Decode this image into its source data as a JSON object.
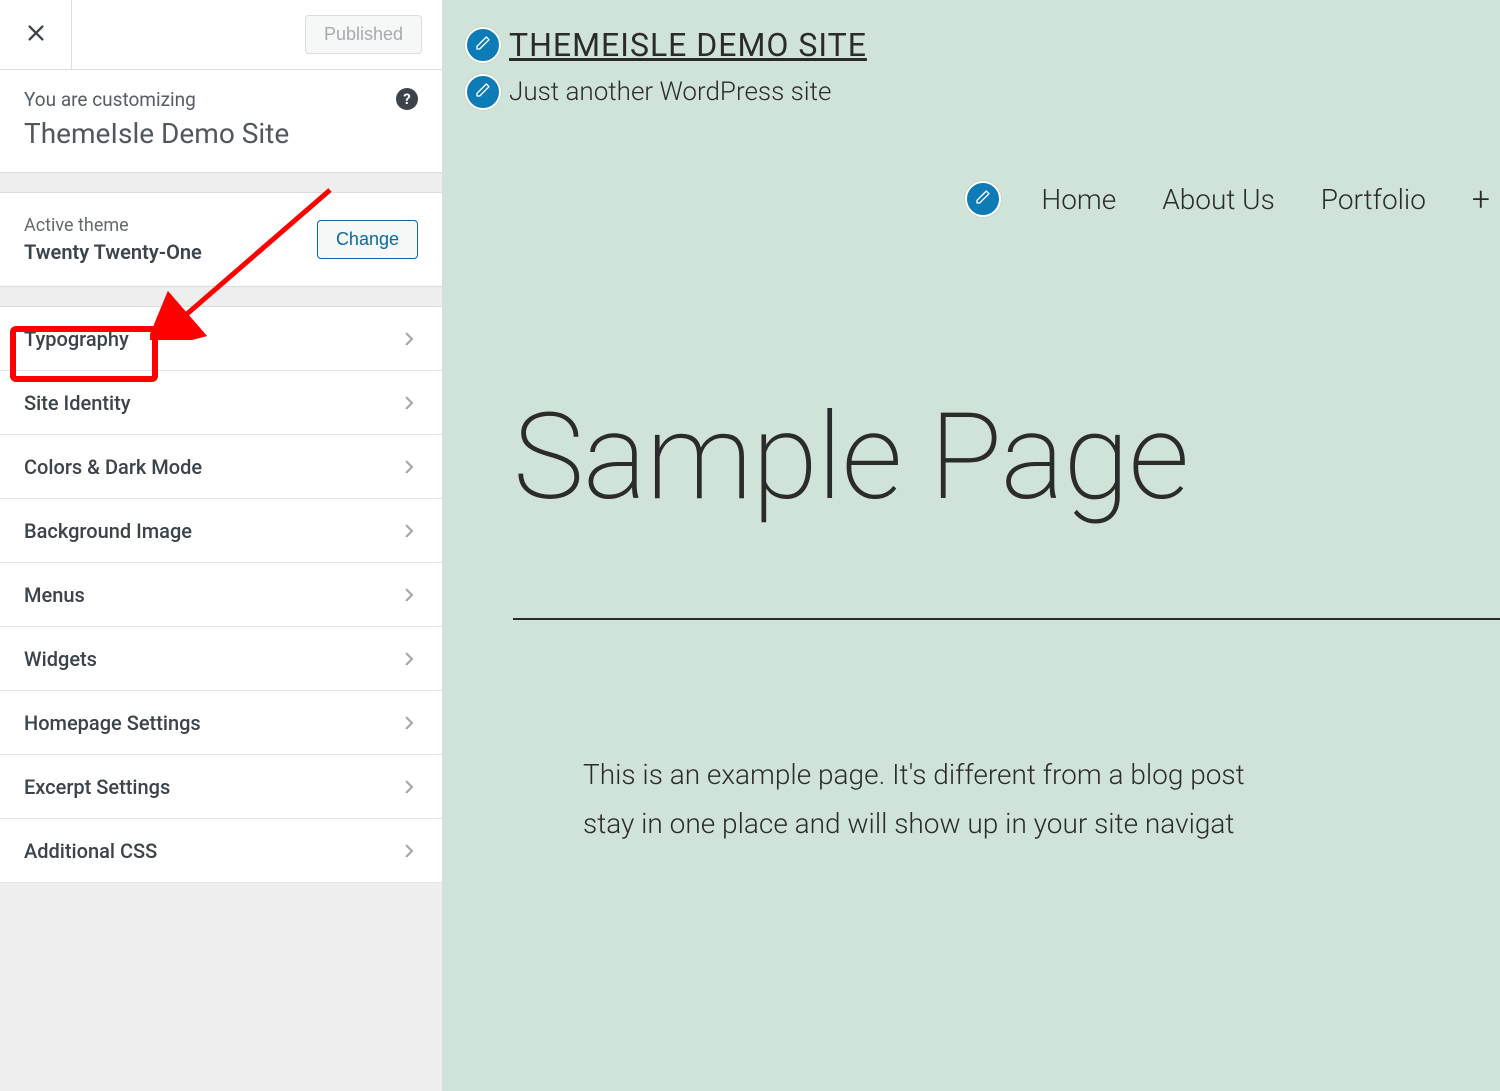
{
  "top": {
    "publish_label": "Published"
  },
  "intro": {
    "small": "You are customizing",
    "title": "ThemeIsle Demo Site"
  },
  "theme": {
    "label": "Active theme",
    "name": "Twenty Twenty-One",
    "change_label": "Change"
  },
  "menu": {
    "items": [
      "Typography",
      "Site Identity",
      "Colors & Dark Mode",
      "Background Image",
      "Menus",
      "Widgets",
      "Homepage Settings",
      "Excerpt Settings",
      "Additional CSS"
    ]
  },
  "preview": {
    "site_title": "THEMEISLE DEMO SITE",
    "tagline": "Just another WordPress site",
    "nav": [
      "Home",
      "About Us",
      "Portfolio"
    ],
    "nav_more": "+",
    "page_title": "Sample Page",
    "body_line1": "This is an example page. It's different from a blog post",
    "body_line2": "stay in one place and will show up in your site navigat"
  },
  "colors": {
    "accent_blue": "#0d7bb5",
    "preview_bg": "#cfe3d9",
    "highlight_red": "#ff0000"
  }
}
